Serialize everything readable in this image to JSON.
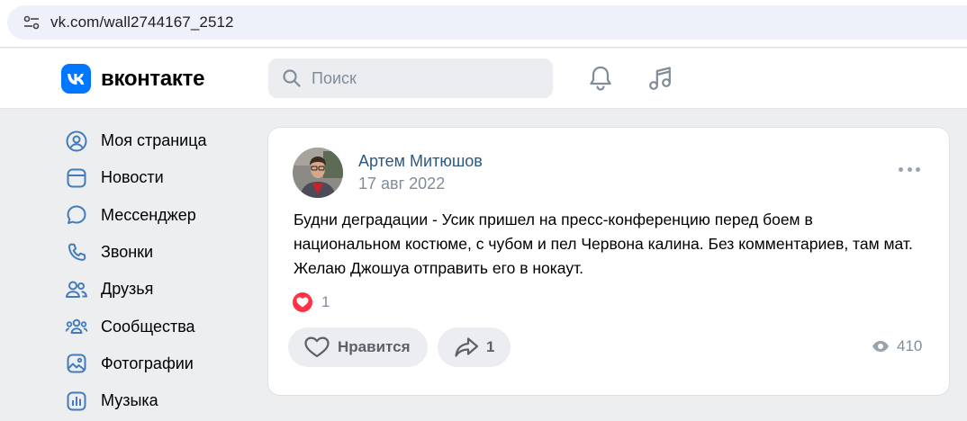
{
  "browser": {
    "url": "vk.com/wall2744167_2512",
    "site_info_icon": "tune-icon"
  },
  "header": {
    "logo_text": "вконтакте",
    "search_placeholder": "Поиск",
    "icons": [
      "bell-icon",
      "music-note-icon"
    ]
  },
  "sidebar": {
    "items": [
      {
        "label": "Моя страница",
        "icon": "user-circle-icon"
      },
      {
        "label": "Новости",
        "icon": "news-icon"
      },
      {
        "label": "Мессенджер",
        "icon": "message-icon"
      },
      {
        "label": "Звонки",
        "icon": "phone-icon"
      },
      {
        "label": "Друзья",
        "icon": "friends-icon"
      },
      {
        "label": "Сообщества",
        "icon": "communities-icon"
      },
      {
        "label": "Фотографии",
        "icon": "photo-icon"
      },
      {
        "label": "Музыка",
        "icon": "music-icon"
      }
    ]
  },
  "post": {
    "author": "Артем Митюшов",
    "date": "17 авг 2022",
    "text": "Будни деградации - Усик пришел на пресс-конференцию перед боем в национальном костюме, с чубом и пел Червона калина. Без комментариев, там мат. Желаю Джошуа отправить его в нокаут.",
    "reaction_count": "1",
    "like_label": "Нравится",
    "share_count": "1",
    "views": "410"
  },
  "colors": {
    "accent": "#0077ff",
    "link": "#2a5885",
    "icon": "#447bba",
    "muted": "#818c99",
    "heart": "#ff3347"
  }
}
